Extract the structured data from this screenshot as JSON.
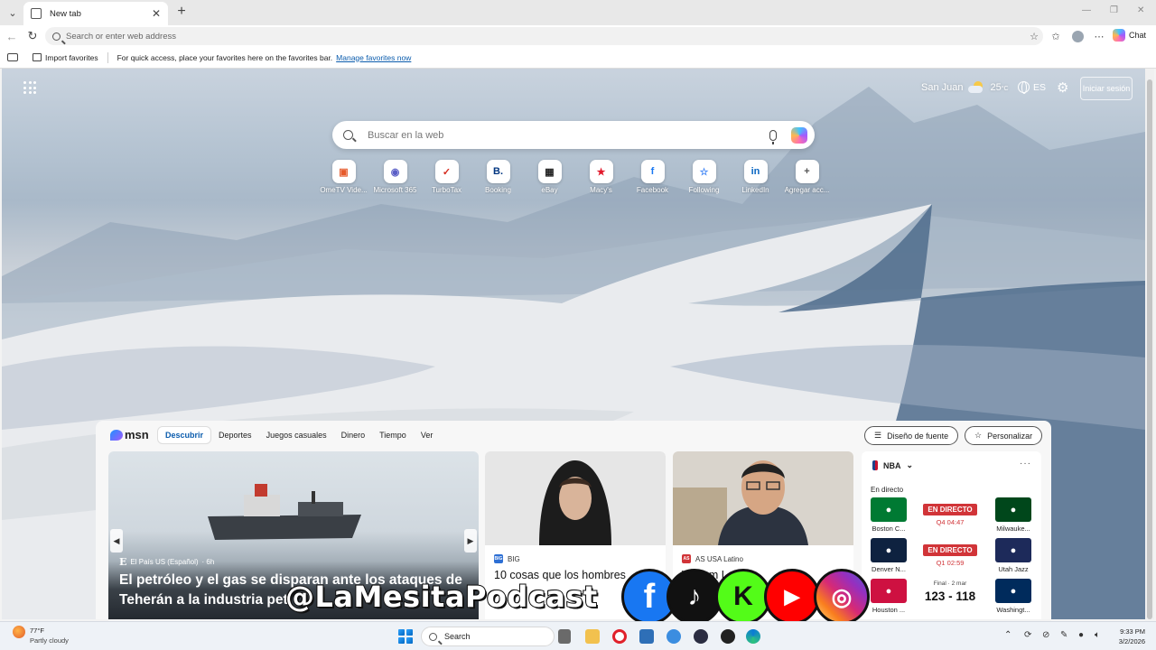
{
  "browser": {
    "tab": {
      "title": "New tab"
    },
    "address_placeholder": "Search or enter web address",
    "chat_label": "Chat",
    "favorites": {
      "import_label": "Import favorites",
      "hint": "For quick access, place your favorites here on the favorites bar.",
      "manage_link": "Manage favorites now"
    }
  },
  "ntp": {
    "weather": {
      "city": "San Juan",
      "temp": "25",
      "unit": "°C"
    },
    "language": "ES",
    "signin_label": "Iniciar sesión",
    "search_placeholder": "Buscar en la web",
    "quicklinks": [
      {
        "label": "OmeTV Vide...",
        "icon": "ometv-icon",
        "color": "#e65a2b",
        "glyph": "▣"
      },
      {
        "label": "Microsoft 365",
        "icon": "microsoft-365-icon",
        "color": "#5b5fc7",
        "glyph": "◉"
      },
      {
        "label": "TurboTax",
        "icon": "turbotax-icon",
        "color": "#d52b1e",
        "glyph": "✓"
      },
      {
        "label": "Booking",
        "icon": "booking-icon",
        "color": "#003580",
        "glyph": "B."
      },
      {
        "label": "eBay",
        "icon": "ebay-icon",
        "color": "#222222",
        "glyph": "▦"
      },
      {
        "label": "Macy's",
        "icon": "macys-icon",
        "color": "#e21a2c",
        "glyph": "★"
      },
      {
        "label": "Facebook",
        "icon": "facebook-icon",
        "color": "#1877f2",
        "glyph": "f"
      },
      {
        "label": "Following",
        "icon": "following-icon",
        "color": "#3b82f6",
        "glyph": "☆"
      },
      {
        "label": "LinkedIn",
        "icon": "linkedin-icon",
        "color": "#0a66c2",
        "glyph": "in"
      },
      {
        "label": "Agregar acc...",
        "icon": "add-shortcut-icon",
        "color": "#555555",
        "glyph": "+"
      }
    ]
  },
  "feed": {
    "logo_text": "msn",
    "tabs": [
      "Descubrir",
      "Deportes",
      "Juegos casuales",
      "Dinero",
      "Tiempo",
      "Ver"
    ],
    "font_button": "Diseño de fuente",
    "personalize_button": "Personalizar",
    "hero": {
      "source": "El País US (Español)",
      "age": "· 6h",
      "headline": "El petróleo y el gas se disparan ante los ataques de Teherán a la industria pet"
    },
    "cards": [
      {
        "source": "BIG",
        "source_color": "#2d6fd4",
        "headline": "10 cosas que los hombres"
      },
      {
        "source": "AS USA Latino",
        "source_color": "#d13438",
        "headline": "William Lai dic"
      }
    ],
    "nba": {
      "league": "NBA",
      "live_label": "En directo",
      "games": [
        {
          "home": "Boston C...",
          "away": "Milwauke...",
          "status": "EN DIRECTO",
          "clock": "Q4 04:47",
          "home_color": "#007a33",
          "away_color": "#00471b"
        },
        {
          "home": "Denver N...",
          "away": "Utah Jazz",
          "status": "EN DIRECTO",
          "clock": "Q1 02:59",
          "home_color": "#0e2240",
          "away_color": "#1d2a5a"
        },
        {
          "home": "Houston ...",
          "away": "Washingt...",
          "final_label": "Final · 2 mar",
          "score": "123 - 118",
          "home_color": "#ce1141",
          "away_color": "#002b5c"
        }
      ]
    }
  },
  "overlay": {
    "handle": "@LaMesitaPodcast"
  },
  "taskbar": {
    "weather_temp": "77°F",
    "weather_desc": "Partly cloudy",
    "search_label": "Search",
    "time": "9:33 PM",
    "date": "3/2/2026"
  }
}
